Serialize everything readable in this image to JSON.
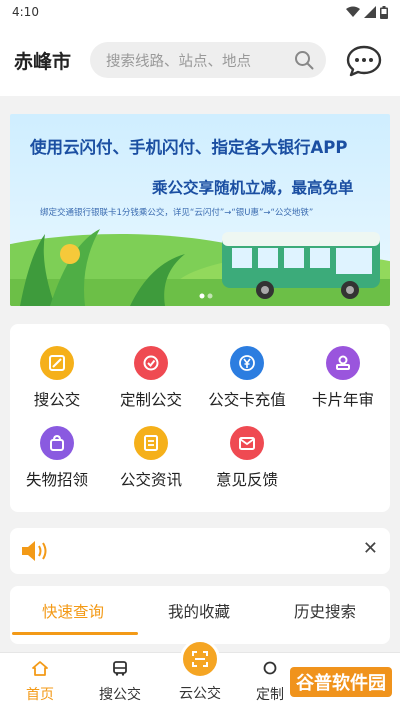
{
  "status": {
    "time": "4:10"
  },
  "header": {
    "city": "赤峰市",
    "search_placeholder": "搜索线路、站点、地点"
  },
  "banner": {
    "line1": "使用云闪付、手机闪付、指定各大银行APP",
    "line2": "乘公交享随机立减，最高免单",
    "line3": "绑定交通银行银联卡1分钱乘公交，详见“云闪付”→“银U惠”→“公交地铁”"
  },
  "menu": {
    "items": [
      {
        "label": "搜公交",
        "color": "#f5b01a",
        "icon": "bus-search-icon"
      },
      {
        "label": "定制公交",
        "color": "#ef4a52",
        "icon": "custom-bus-icon"
      },
      {
        "label": "公交卡充值",
        "color": "#2c7de0",
        "icon": "yuan-icon"
      },
      {
        "label": "卡片年审",
        "color": "#9a55dd",
        "icon": "stamp-icon"
      },
      {
        "label": "失物招领",
        "color": "#8a5ae0",
        "icon": "bag-icon"
      },
      {
        "label": "公交资讯",
        "color": "#f5b01a",
        "icon": "news-icon"
      },
      {
        "label": "意见反馈",
        "color": "#ef4a52",
        "icon": "feedback-icon"
      }
    ]
  },
  "tabs": [
    {
      "label": "快速查询",
      "active": true
    },
    {
      "label": "我的收藏",
      "active": false
    },
    {
      "label": "历史搜索",
      "active": false
    }
  ],
  "nav": {
    "items": [
      {
        "label": "首页",
        "active": true
      },
      {
        "label": "搜公交",
        "active": false
      },
      {
        "label": "云公交",
        "active": false
      },
      {
        "label": "定制",
        "active": false
      }
    ]
  },
  "watermark": "谷普软件园",
  "colors": {
    "accent": "#f39a17",
    "banner_text": "#1b4fa2"
  }
}
